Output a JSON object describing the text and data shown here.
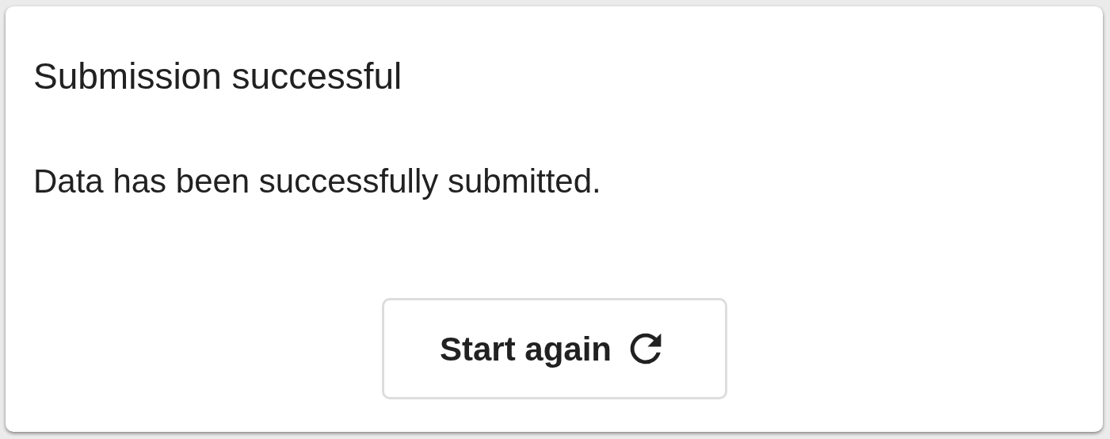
{
  "title": "Submission successful",
  "message": "Data has been successfully submitted.",
  "button": {
    "label": "Start again"
  }
}
